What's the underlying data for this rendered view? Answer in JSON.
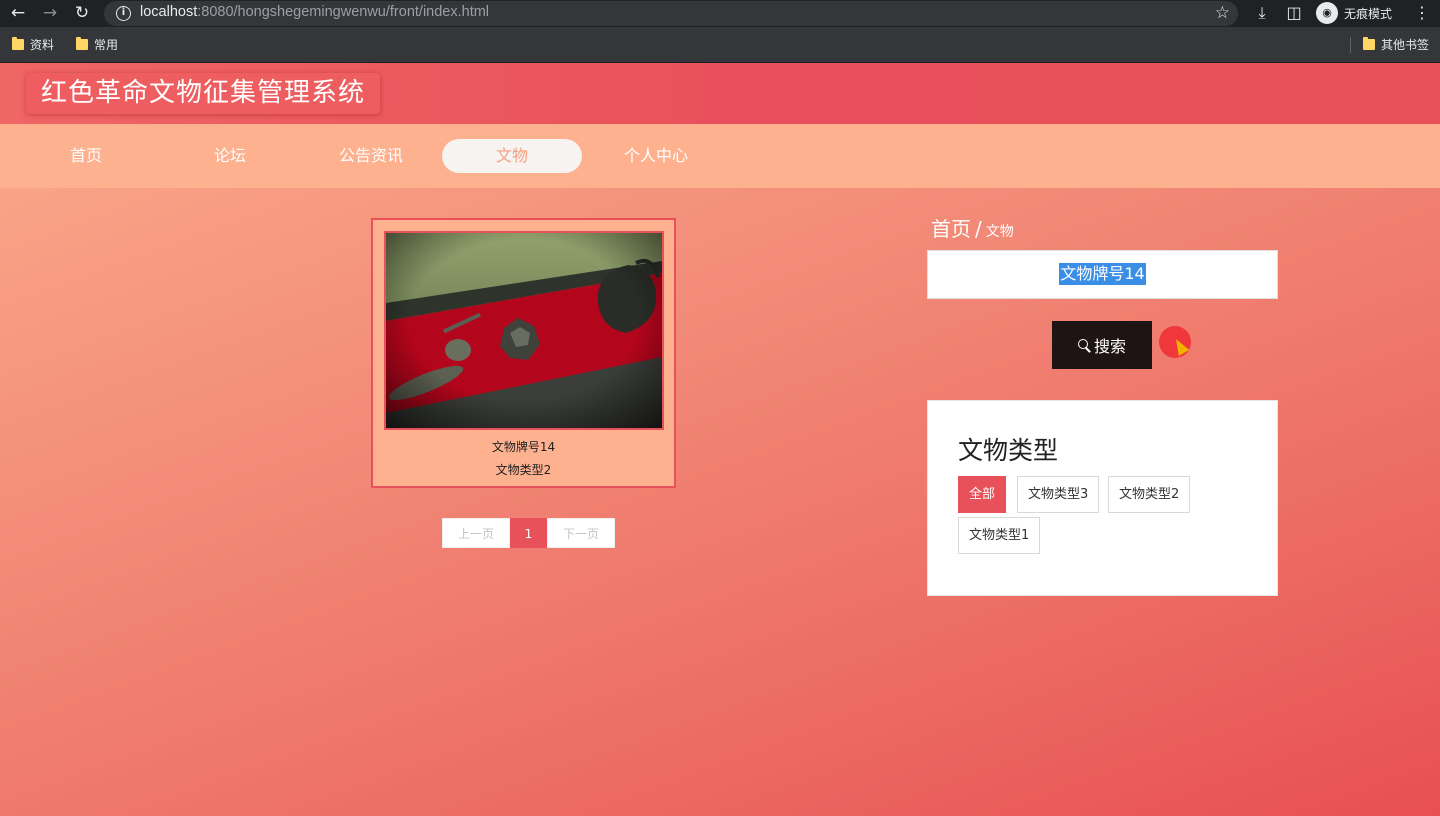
{
  "browser": {
    "url_host": "localhost",
    "url_rest": ":8080/hongshegemingwenwu/front/index.html",
    "incognito_label": "无痕模式",
    "bookmarks": [
      "资料",
      "常用"
    ],
    "other_bookmarks": "其他书签"
  },
  "site": {
    "title": "红色革命文物征集管理系统"
  },
  "nav": {
    "items": [
      "首页",
      "论坛",
      "公告资讯",
      "文物",
      "个人中心"
    ],
    "active": "文物"
  },
  "card": {
    "name": "文物牌号14",
    "type": "文物类型2"
  },
  "pager": {
    "prev": "上一页",
    "current": "1",
    "next": "下一页"
  },
  "breadcrumb": {
    "home": "首页",
    "separator": "/",
    "current": "文物"
  },
  "search": {
    "value": "文物牌号14",
    "button_label": "搜索"
  },
  "types": {
    "title": "文物类型",
    "tags": [
      "全部",
      "文物类型3",
      "文物类型2",
      "文物类型1"
    ],
    "active": "全部"
  },
  "colors": {
    "header": "#e8505a",
    "nav_bg": "#fdb18f",
    "accent": "#e8505a",
    "search_button": "#1f1414"
  }
}
